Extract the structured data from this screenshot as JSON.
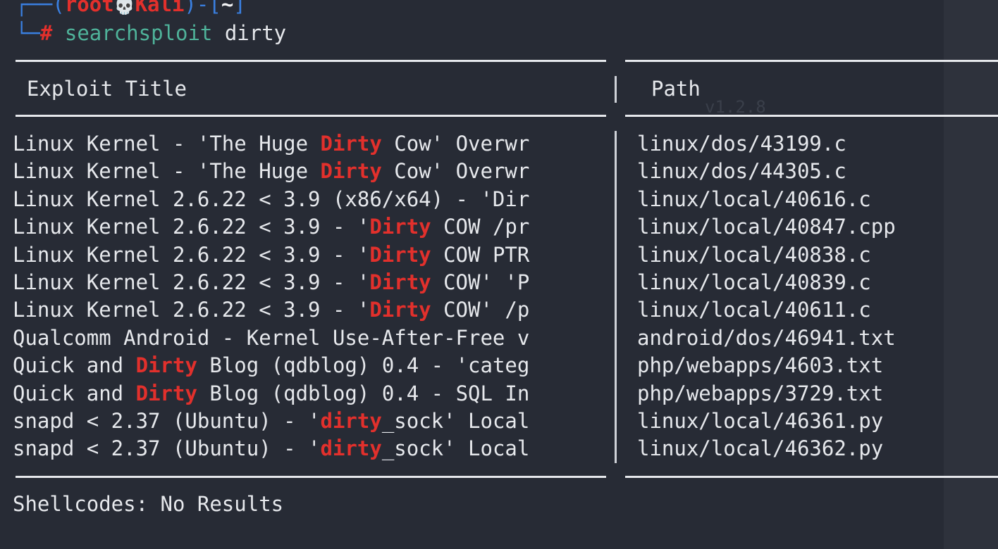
{
  "prompt": {
    "open": "┌──(",
    "user": "root",
    "skull": "💀",
    "host": "Kali",
    "mid": ")-[",
    "dir": "~",
    "close": "]",
    "corner": "└─",
    "hash": "#",
    "command": "searchsploit",
    "argument": "dirty"
  },
  "table": {
    "header_title": "Exploit Title",
    "header_path": "Path",
    "faint_text": "v1.2.8",
    "rows": [
      {
        "pre": "Linux Kernel - 'The Huge ",
        "hl": "Dirty",
        "post": " Cow' Overwr",
        "path": "linux/dos/43199.c"
      },
      {
        "pre": "Linux Kernel - 'The Huge ",
        "hl": "Dirty",
        "post": " Cow' Overwr",
        "path": "linux/dos/44305.c"
      },
      {
        "pre": "Linux Kernel 2.6.22 < 3.9 (x86/x64) - 'Dir",
        "hl": "",
        "post": "",
        "path": "linux/local/40616.c"
      },
      {
        "pre": "Linux Kernel 2.6.22 < 3.9 - '",
        "hl": "Dirty",
        "post": " COW /pr",
        "path": "linux/local/40847.cpp"
      },
      {
        "pre": "Linux Kernel 2.6.22 < 3.9 - '",
        "hl": "Dirty",
        "post": " COW PTR",
        "path": "linux/local/40838.c"
      },
      {
        "pre": "Linux Kernel 2.6.22 < 3.9 - '",
        "hl": "Dirty",
        "post": " COW' 'P",
        "path": "linux/local/40839.c"
      },
      {
        "pre": "Linux Kernel 2.6.22 < 3.9 - '",
        "hl": "Dirty",
        "post": " COW' /p",
        "path": "linux/local/40611.c"
      },
      {
        "pre": "Qualcomm Android - Kernel Use-After-Free v",
        "hl": "",
        "post": "",
        "path": "android/dos/46941.txt"
      },
      {
        "pre": "Quick and ",
        "hl": "Dirty",
        "post": " Blog (qdblog) 0.4 - 'categ",
        "path": "php/webapps/4603.txt"
      },
      {
        "pre": "Quick and ",
        "hl": "Dirty",
        "post": " Blog (qdblog) 0.4 - SQL In",
        "path": "php/webapps/3729.txt"
      },
      {
        "pre": "snapd < 2.37 (Ubuntu) - '",
        "hl": "dirty",
        "post": "_sock' Local",
        "path": "linux/local/46361.py"
      },
      {
        "pre": "snapd < 2.37 (Ubuntu) - '",
        "hl": "dirty",
        "post": "_sock' Local",
        "path": "linux/local/46362.py"
      }
    ]
  },
  "shellcodes": "Shellcodes: No Results",
  "colors": {
    "background": "#272b35",
    "prompt_frame": "#3a7fe0",
    "prompt_user": "#e2302c",
    "command": "#4fb39a",
    "highlight": "#e2302c",
    "text": "#e6e8ec"
  }
}
